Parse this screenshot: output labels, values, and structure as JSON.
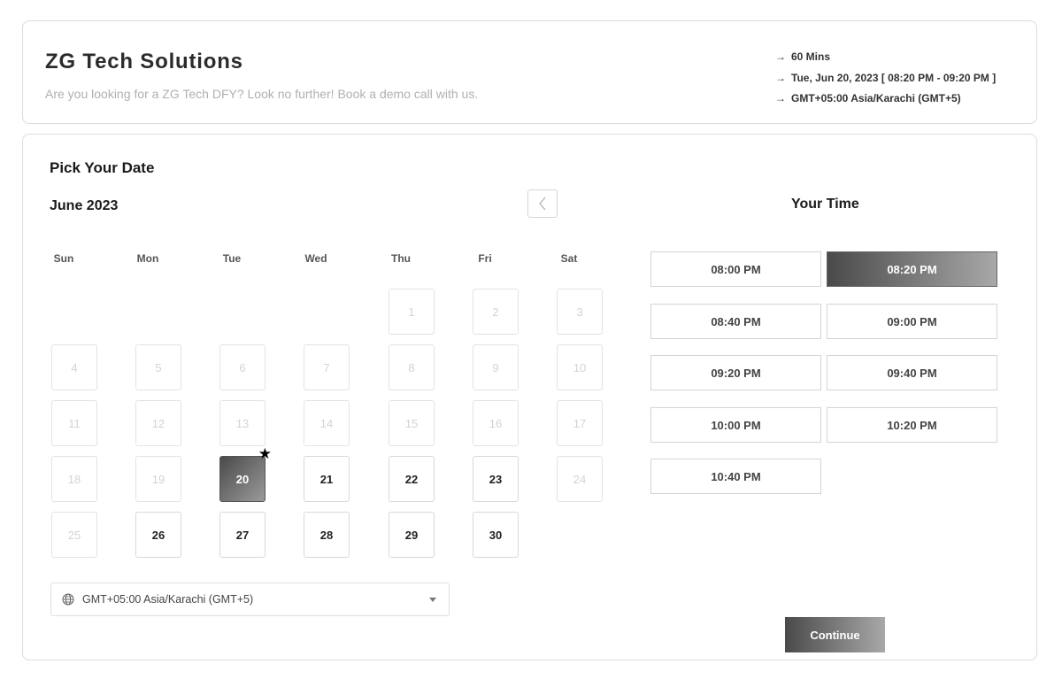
{
  "header": {
    "company_name": "ZG Tech Solutions",
    "description": "Are you looking for a ZG Tech DFY? Look no further! Book a demo call with us.",
    "meta": [
      {
        "arrow": "→",
        "text": "60 Mins"
      },
      {
        "arrow": "→",
        "text": "Tue, Jun 20, 2023 [ 08:20 PM - 09:20 PM ]"
      },
      {
        "arrow": "→",
        "text": "GMT+05:00 Asia/Karachi (GMT+5)"
      }
    ]
  },
  "calendar": {
    "pick_title": "Pick Your Date",
    "month_label": "June 2023",
    "prev_icon": "chevron-left-icon",
    "weekdays": [
      "Sun",
      "Mon",
      "Tue",
      "Wed",
      "Thu",
      "Fri",
      "Sat"
    ],
    "days": [
      {
        "label": "1",
        "state": "disabled"
      },
      {
        "label": "2",
        "state": "disabled"
      },
      {
        "label": "3",
        "state": "disabled"
      },
      {
        "label": "4",
        "state": "disabled"
      },
      {
        "label": "5",
        "state": "disabled"
      },
      {
        "label": "6",
        "state": "disabled"
      },
      {
        "label": "7",
        "state": "disabled"
      },
      {
        "label": "8",
        "state": "disabled"
      },
      {
        "label": "9",
        "state": "disabled"
      },
      {
        "label": "10",
        "state": "disabled"
      },
      {
        "label": "11",
        "state": "disabled"
      },
      {
        "label": "12",
        "state": "disabled"
      },
      {
        "label": "13",
        "state": "disabled"
      },
      {
        "label": "14",
        "state": "disabled"
      },
      {
        "label": "15",
        "state": "disabled"
      },
      {
        "label": "16",
        "state": "disabled"
      },
      {
        "label": "17",
        "state": "disabled"
      },
      {
        "label": "18",
        "state": "disabled"
      },
      {
        "label": "19",
        "state": "disabled"
      },
      {
        "label": "20",
        "state": "selected"
      },
      {
        "label": "21",
        "state": "available"
      },
      {
        "label": "22",
        "state": "available"
      },
      {
        "label": "23",
        "state": "available"
      },
      {
        "label": "24",
        "state": "disabled"
      },
      {
        "label": "25",
        "state": "disabled"
      },
      {
        "label": "26",
        "state": "available"
      },
      {
        "label": "27",
        "state": "available"
      },
      {
        "label": "28",
        "state": "available"
      },
      {
        "label": "29",
        "state": "available"
      },
      {
        "label": "30",
        "state": "available"
      }
    ],
    "timezone": "GMT+05:00 Asia/Karachi (GMT+5)",
    "timezone_icon": "globe-icon"
  },
  "time": {
    "title": "Your Time",
    "slots": [
      {
        "label": "08:00 PM",
        "selected": false
      },
      {
        "label": "08:20 PM",
        "selected": true
      },
      {
        "label": "08:40 PM",
        "selected": false
      },
      {
        "label": "09:00 PM",
        "selected": false
      },
      {
        "label": "09:20 PM",
        "selected": false
      },
      {
        "label": "09:40 PM",
        "selected": false
      },
      {
        "label": "10:00 PM",
        "selected": false
      },
      {
        "label": "10:20 PM",
        "selected": false
      },
      {
        "label": "10:40 PM",
        "selected": false
      }
    ]
  },
  "actions": {
    "continue_label": "Continue"
  }
}
